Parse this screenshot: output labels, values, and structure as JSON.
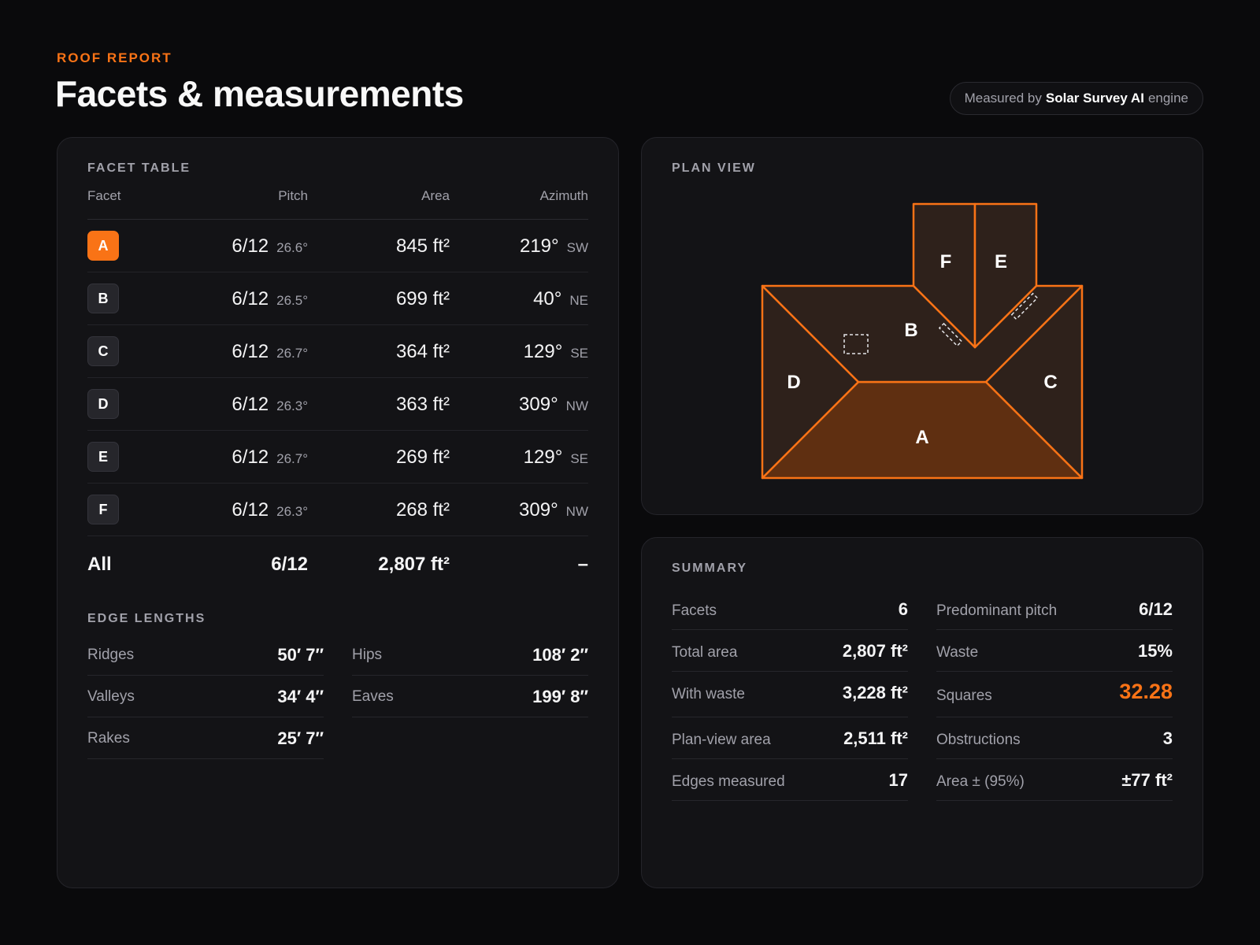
{
  "header": {
    "eyebrow": "ROOF REPORT",
    "title": "Facets & measurements",
    "engine_prefix": "Measured by",
    "engine_name": "Solar Survey AI",
    "engine_suffix": "engine"
  },
  "facet_table": {
    "label": "FACET TABLE",
    "columns": [
      "Facet",
      "Pitch",
      "Area",
      "Azimuth"
    ],
    "rows": [
      {
        "facet": "A",
        "pitch": "6/12",
        "pitch_deg": "26.6°",
        "area": "845 ft²",
        "azimuth": "219°",
        "dir": "SW",
        "active": true
      },
      {
        "facet": "B",
        "pitch": "6/12",
        "pitch_deg": "26.5°",
        "area": "699 ft²",
        "azimuth": "40°",
        "dir": "NE",
        "active": false
      },
      {
        "facet": "C",
        "pitch": "6/12",
        "pitch_deg": "26.7°",
        "area": "364 ft²",
        "azimuth": "129°",
        "dir": "SE",
        "active": false
      },
      {
        "facet": "D",
        "pitch": "6/12",
        "pitch_deg": "26.3°",
        "area": "363 ft²",
        "azimuth": "309°",
        "dir": "NW",
        "active": false
      },
      {
        "facet": "E",
        "pitch": "6/12",
        "pitch_deg": "26.7°",
        "area": "269 ft²",
        "azimuth": "129°",
        "dir": "SE",
        "active": false
      },
      {
        "facet": "F",
        "pitch": "6/12",
        "pitch_deg": "26.3°",
        "area": "268 ft²",
        "azimuth": "309°",
        "dir": "NW",
        "active": false
      }
    ],
    "total": {
      "label": "All",
      "pitch": "6/12",
      "area": "2,807 ft²",
      "azimuth": "–"
    }
  },
  "edge_lengths": {
    "label": "EDGE LENGTHS",
    "items": [
      {
        "name": "Ridges",
        "value": "50′ 7″"
      },
      {
        "name": "Hips",
        "value": "108′ 2″"
      },
      {
        "name": "Valleys",
        "value": "34′ 4″"
      },
      {
        "name": "Eaves",
        "value": "199′ 8″"
      },
      {
        "name": "Rakes",
        "value": "25′ 7″"
      }
    ]
  },
  "plan_view": {
    "label": "PLAN VIEW",
    "facet_labels": [
      "A",
      "B",
      "C",
      "D",
      "E",
      "F"
    ],
    "accent_color": "#f97316"
  },
  "summary": {
    "label": "SUMMARY",
    "left": [
      {
        "name": "Facets",
        "value": "6"
      },
      {
        "name": "Total area",
        "value": "2,807 ft²"
      },
      {
        "name": "With waste",
        "value": "3,228 ft²"
      },
      {
        "name": "Plan-view area",
        "value": "2,511 ft²"
      },
      {
        "name": "Edges measured",
        "value": "17"
      }
    ],
    "right": [
      {
        "name": "Predominant pitch",
        "value": "6/12"
      },
      {
        "name": "Waste",
        "value": "15%"
      },
      {
        "name": "Squares",
        "value": "32.28"
      },
      {
        "name": "Obstructions",
        "value": "3"
      },
      {
        "name": "Area ± (95%)",
        "value": "±77 ft²"
      }
    ]
  }
}
